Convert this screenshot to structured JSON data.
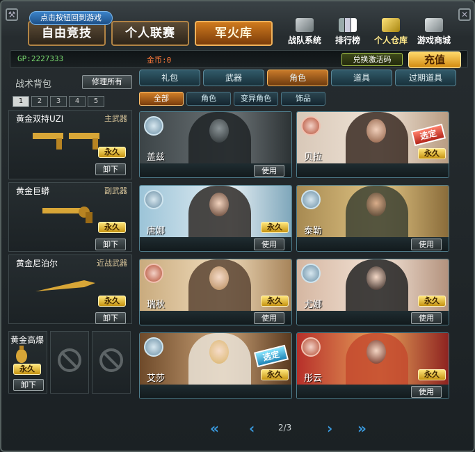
{
  "top": {
    "return_hint": "点击按钮回到游戏",
    "modes": [
      "自由竞技",
      "个人联赛",
      "军火库"
    ],
    "systems": [
      {
        "label": "战队系统",
        "icon": "team-icon"
      },
      {
        "label": "排行榜",
        "icon": "ranking-icon"
      },
      {
        "label": "个人仓库",
        "icon": "warehouse-icon"
      },
      {
        "label": "游戏商城",
        "icon": "shop-cart-icon"
      }
    ]
  },
  "status": {
    "gp": "GP:2227333",
    "gold": "金币:0",
    "redeem_label": "兑换激活码",
    "recharge_label": "充值"
  },
  "bag": {
    "title": "战术背包",
    "repair_label": "修理所有",
    "tabs": [
      "1",
      "2",
      "3",
      "4",
      "5"
    ],
    "slots": [
      {
        "name": "黄金双持UZI",
        "type": "主武器",
        "perm": "永久",
        "action": "卸下"
      },
      {
        "name": "黄金巨蟒",
        "type": "副武器",
        "perm": "永久",
        "action": "卸下"
      },
      {
        "name": "黄金尼泊尔",
        "type": "近战武器",
        "perm": "永久",
        "action": "卸下"
      }
    ],
    "mini": {
      "name": "黄金高爆",
      "perm": "永久",
      "action": "卸下"
    }
  },
  "categories": [
    "礼包",
    "武器",
    "角色",
    "道具",
    "过期道具"
  ],
  "subcategories": [
    "全部",
    "角色",
    "变异角色",
    "饰品"
  ],
  "cards": [
    {
      "name": "盖兹",
      "perm": "",
      "action": "使用",
      "chosen": ""
    },
    {
      "name": "贝拉",
      "perm": "永久",
      "action": "",
      "chosen": "选定"
    },
    {
      "name": "唐娜",
      "perm": "永久",
      "action": "使用",
      "chosen": ""
    },
    {
      "name": "泰勒",
      "perm": "",
      "action": "使用",
      "chosen": ""
    },
    {
      "name": "瑞秋",
      "perm": "永久",
      "action": "使用",
      "chosen": ""
    },
    {
      "name": "尤娜",
      "perm": "永久",
      "action": "使用",
      "chosen": ""
    },
    {
      "name": "艾莎",
      "perm": "永久",
      "action": "",
      "chosen": "选定"
    },
    {
      "name": "彤云",
      "perm": "永久",
      "action": "使用",
      "chosen": ""
    }
  ],
  "pager": {
    "label": "2/3"
  },
  "colors": {
    "accent": "#d17f28",
    "gold_text": "#ff7a3a",
    "gp_text": "#79d96f",
    "tab_blue": "#315a69"
  }
}
